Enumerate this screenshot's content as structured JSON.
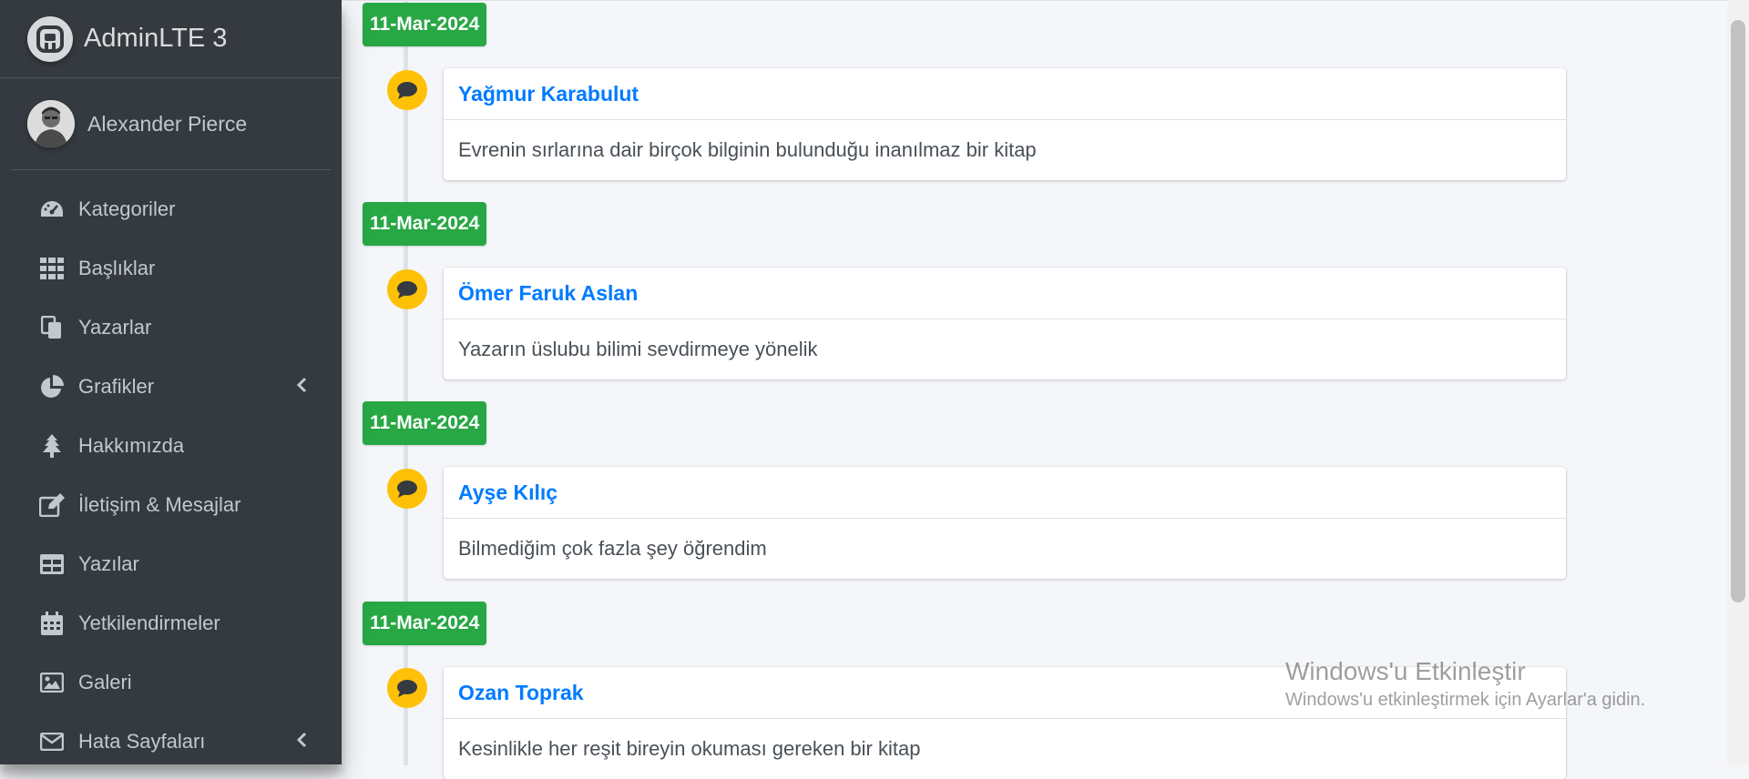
{
  "brand": {
    "name": "AdminLTE 3",
    "icon": "adminlte-logo-icon"
  },
  "user": {
    "name": "Alexander Pierce",
    "avatar": "user-avatar"
  },
  "sidebar": {
    "items": [
      {
        "label": "Kategoriler",
        "icon": "tachometer-icon"
      },
      {
        "label": "Başlıklar",
        "icon": "grid-icon"
      },
      {
        "label": "Yazarlar",
        "icon": "copy-icon"
      },
      {
        "label": "Grafikler",
        "icon": "pie-chart-icon",
        "has_submenu": true
      },
      {
        "label": "Hakkımızda",
        "icon": "tree-icon"
      },
      {
        "label": "İletişim & Mesajlar",
        "icon": "edit-icon"
      },
      {
        "label": "Yazılar",
        "icon": "table-icon"
      },
      {
        "label": "Yetkilendirmeler",
        "icon": "calendar-icon"
      },
      {
        "label": "Galeri",
        "icon": "image-icon"
      },
      {
        "label": "Hata Sayfaları",
        "icon": "envelope-icon",
        "has_submenu": true
      }
    ]
  },
  "timeline": [
    {
      "date": "11-Mar-2024",
      "author": "Yağmur Karabulut",
      "comment": "Evrenin sırlarına dair birçok bilginin bulunduğu inanılmaz bir kitap"
    },
    {
      "date": "11-Mar-2024",
      "author": "Ömer Faruk Aslan",
      "comment": "Yazarın üslubu bilimi sevdirmeye yönelik"
    },
    {
      "date": "11-Mar-2024",
      "author": "Ayşe Kılıç",
      "comment": "Bilmediğim çok fazla şey öğrendim"
    },
    {
      "date": "11-Mar-2024",
      "author": "Ozan Toprak",
      "comment": "Kesinlikle her reşit bireyin okuması gereken bir kitap"
    }
  ],
  "watermark": {
    "title": "Windows'u Etkinleştir",
    "subtitle": "Windows'u etkinleştirmek için Ayarlar'a gidin."
  },
  "colors": {
    "sidebar_bg": "#343a40",
    "time_label": "#28a745",
    "comment_icon": "#ffc107",
    "author_link": "#007bff"
  }
}
